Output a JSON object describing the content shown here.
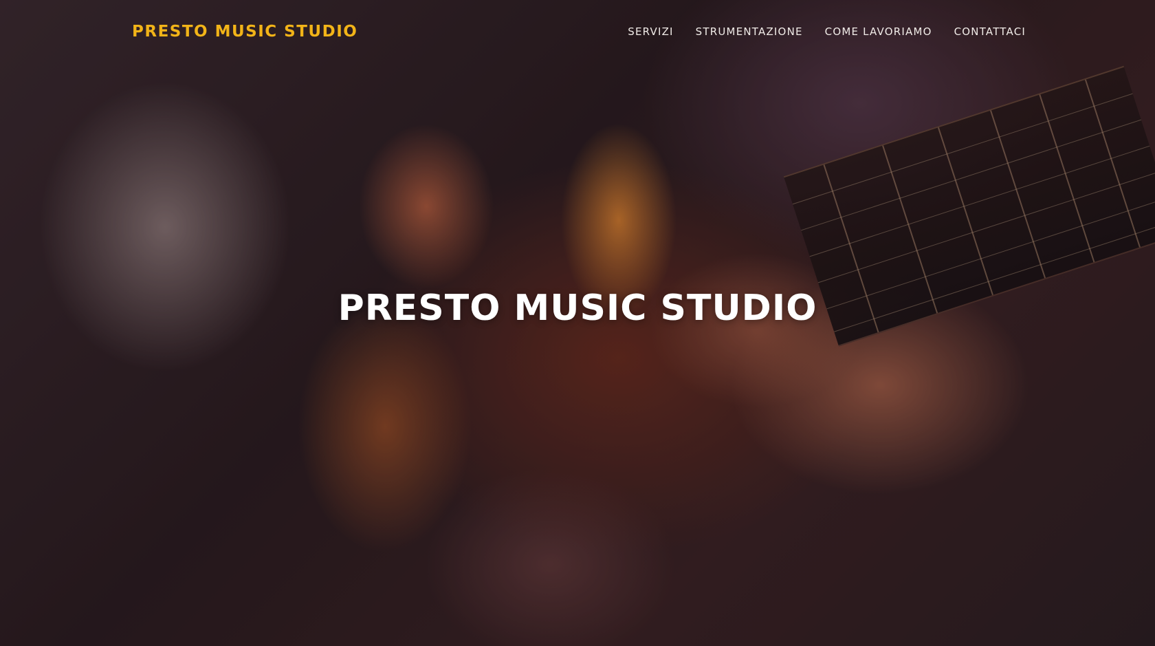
{
  "header": {
    "brand": "PRESTO MUSIC STUDIO",
    "nav": [
      {
        "label": "SERVIZI"
      },
      {
        "label": "STRUMENTAZIONE"
      },
      {
        "label": "COME LAVORIAMO"
      },
      {
        "label": "CONTATTACI"
      }
    ]
  },
  "hero": {
    "title": "PRESTO MUSIC STUDIO",
    "background_subject": "guitar-photo"
  },
  "colors": {
    "brand": "#f2b418",
    "nav_text": "#f1ece8",
    "hero_text": "#ffffff"
  }
}
